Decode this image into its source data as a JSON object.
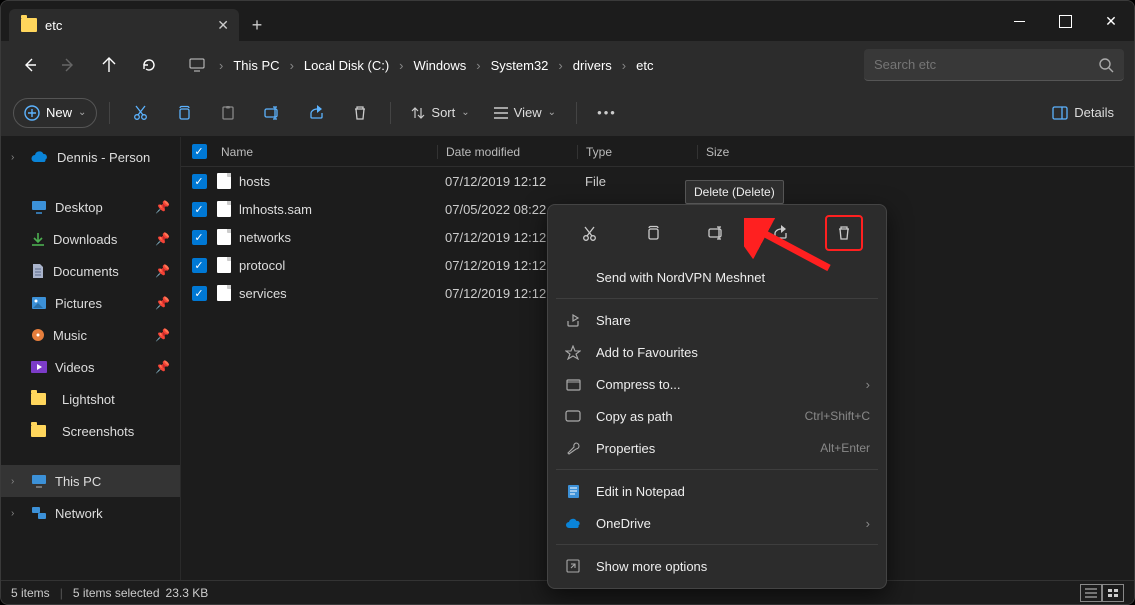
{
  "tab_title": "etc",
  "breadcrumb": [
    "This PC",
    "Local Disk (C:)",
    "Windows",
    "System32",
    "drivers",
    "etc"
  ],
  "search_placeholder": "Search etc",
  "toolbar": {
    "new": "New",
    "sort": "Sort",
    "view": "View",
    "details": "Details"
  },
  "sidebar": {
    "onedrive": "Dennis - Person",
    "desktop": "Desktop",
    "downloads": "Downloads",
    "documents": "Documents",
    "pictures": "Pictures",
    "music": "Music",
    "videos": "Videos",
    "lightshot": "Lightshot",
    "screenshots": "Screenshots",
    "thispc": "This PC",
    "network": "Network"
  },
  "columns": {
    "name": "Name",
    "date": "Date modified",
    "type": "Type",
    "size": "Size"
  },
  "files": [
    {
      "name": "hosts",
      "date": "07/12/2019 12:12",
      "type": "File"
    },
    {
      "name": "lmhosts.sam",
      "date": "07/05/2022 08:22",
      "type": ""
    },
    {
      "name": "networks",
      "date": "07/12/2019 12:12",
      "type": ""
    },
    {
      "name": "protocol",
      "date": "07/12/2019 12:12",
      "type": ""
    },
    {
      "name": "services",
      "date": "07/12/2019 12:12",
      "type": ""
    }
  ],
  "context_menu": {
    "send_nordvpn": "Send with NordVPN Meshnet",
    "share": "Share",
    "favourites": "Add to Favourites",
    "compress": "Compress to...",
    "copy_path": "Copy as path",
    "copy_path_hint": "Ctrl+Shift+C",
    "properties": "Properties",
    "properties_hint": "Alt+Enter",
    "notepad": "Edit in Notepad",
    "onedrive": "OneDrive",
    "more": "Show more options"
  },
  "tooltip": "Delete (Delete)",
  "status": {
    "items": "5 items",
    "selected": "5 items selected",
    "size": "23.3 KB"
  }
}
